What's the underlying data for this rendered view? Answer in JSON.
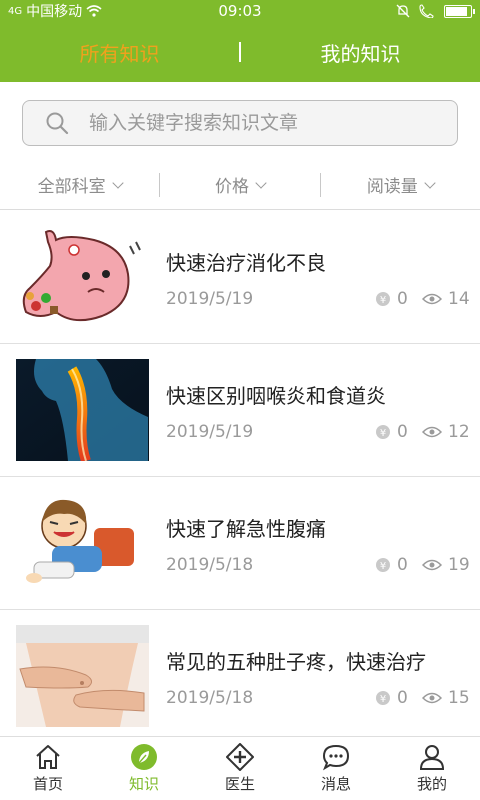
{
  "status": {
    "carrier": "中国移动",
    "time": "09:03",
    "signal": "4G"
  },
  "header": {
    "tabs": [
      {
        "label": "所有知识",
        "active": true
      },
      {
        "label": "我的知识",
        "active": false
      }
    ]
  },
  "search": {
    "placeholder": "输入关键字搜索知识文章"
  },
  "filters": [
    {
      "label": "全部科室"
    },
    {
      "label": "价格"
    },
    {
      "label": "阅读量"
    }
  ],
  "articles": [
    {
      "title": "快速治疗消化不良",
      "date": "2019/5/19",
      "price": "0",
      "views": "14",
      "thumb": "stomach-cartoon"
    },
    {
      "title": "快速区别咽喉炎和食道炎",
      "date": "2019/5/19",
      "price": "0",
      "views": "12",
      "thumb": "throat-xray"
    },
    {
      "title": "快速了解急性腹痛",
      "date": "2019/5/18",
      "price": "0",
      "views": "19",
      "thumb": "child-abdominal-pain"
    },
    {
      "title": "常见的五种肚子疼，快速治疗",
      "date": "2019/5/18",
      "price": "0",
      "views": "15",
      "thumb": "abdomen-hands"
    }
  ],
  "tabbar": [
    {
      "label": "首页",
      "icon": "home-icon",
      "active": false
    },
    {
      "label": "知识",
      "icon": "leaf-icon",
      "active": true
    },
    {
      "label": "医生",
      "icon": "medical-cross-icon",
      "active": false
    },
    {
      "label": "消息",
      "icon": "chat-bubble-icon",
      "active": false
    },
    {
      "label": "我的",
      "icon": "user-icon",
      "active": false
    }
  ],
  "colors": {
    "brand": "#7fbb2c",
    "active_tab": "#f0a11d",
    "muted": "#9a9a9a"
  }
}
